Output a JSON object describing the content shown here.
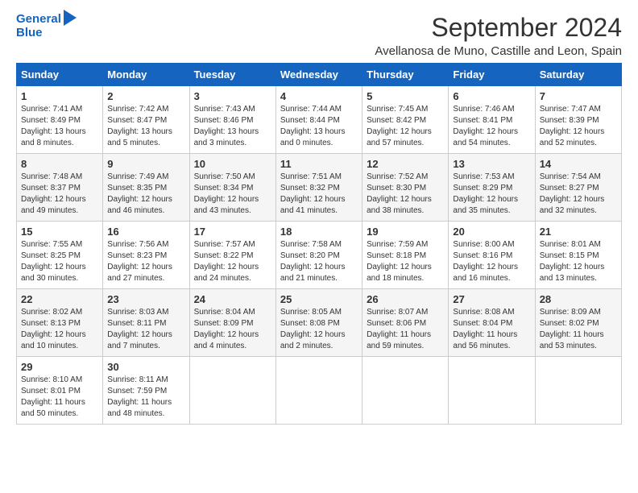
{
  "header": {
    "logo_line1": "General",
    "logo_line2": "Blue",
    "month_title": "September 2024",
    "location": "Avellanosa de Muno, Castille and Leon, Spain"
  },
  "weekdays": [
    "Sunday",
    "Monday",
    "Tuesday",
    "Wednesday",
    "Thursday",
    "Friday",
    "Saturday"
  ],
  "weeks": [
    [
      {
        "day": "1",
        "sunrise": "7:41 AM",
        "sunset": "8:49 PM",
        "daylight": "13 hours and 8 minutes."
      },
      {
        "day": "2",
        "sunrise": "7:42 AM",
        "sunset": "8:47 PM",
        "daylight": "13 hours and 5 minutes."
      },
      {
        "day": "3",
        "sunrise": "7:43 AM",
        "sunset": "8:46 PM",
        "daylight": "13 hours and 3 minutes."
      },
      {
        "day": "4",
        "sunrise": "7:44 AM",
        "sunset": "8:44 PM",
        "daylight": "13 hours and 0 minutes."
      },
      {
        "day": "5",
        "sunrise": "7:45 AM",
        "sunset": "8:42 PM",
        "daylight": "12 hours and 57 minutes."
      },
      {
        "day": "6",
        "sunrise": "7:46 AM",
        "sunset": "8:41 PM",
        "daylight": "12 hours and 54 minutes."
      },
      {
        "day": "7",
        "sunrise": "7:47 AM",
        "sunset": "8:39 PM",
        "daylight": "12 hours and 52 minutes."
      }
    ],
    [
      {
        "day": "8",
        "sunrise": "7:48 AM",
        "sunset": "8:37 PM",
        "daylight": "12 hours and 49 minutes."
      },
      {
        "day": "9",
        "sunrise": "7:49 AM",
        "sunset": "8:35 PM",
        "daylight": "12 hours and 46 minutes."
      },
      {
        "day": "10",
        "sunrise": "7:50 AM",
        "sunset": "8:34 PM",
        "daylight": "12 hours and 43 minutes."
      },
      {
        "day": "11",
        "sunrise": "7:51 AM",
        "sunset": "8:32 PM",
        "daylight": "12 hours and 41 minutes."
      },
      {
        "day": "12",
        "sunrise": "7:52 AM",
        "sunset": "8:30 PM",
        "daylight": "12 hours and 38 minutes."
      },
      {
        "day": "13",
        "sunrise": "7:53 AM",
        "sunset": "8:29 PM",
        "daylight": "12 hours and 35 minutes."
      },
      {
        "day": "14",
        "sunrise": "7:54 AM",
        "sunset": "8:27 PM",
        "daylight": "12 hours and 32 minutes."
      }
    ],
    [
      {
        "day": "15",
        "sunrise": "7:55 AM",
        "sunset": "8:25 PM",
        "daylight": "12 hours and 30 minutes."
      },
      {
        "day": "16",
        "sunrise": "7:56 AM",
        "sunset": "8:23 PM",
        "daylight": "12 hours and 27 minutes."
      },
      {
        "day": "17",
        "sunrise": "7:57 AM",
        "sunset": "8:22 PM",
        "daylight": "12 hours and 24 minutes."
      },
      {
        "day": "18",
        "sunrise": "7:58 AM",
        "sunset": "8:20 PM",
        "daylight": "12 hours and 21 minutes."
      },
      {
        "day": "19",
        "sunrise": "7:59 AM",
        "sunset": "8:18 PM",
        "daylight": "12 hours and 18 minutes."
      },
      {
        "day": "20",
        "sunrise": "8:00 AM",
        "sunset": "8:16 PM",
        "daylight": "12 hours and 16 minutes."
      },
      {
        "day": "21",
        "sunrise": "8:01 AM",
        "sunset": "8:15 PM",
        "daylight": "12 hours and 13 minutes."
      }
    ],
    [
      {
        "day": "22",
        "sunrise": "8:02 AM",
        "sunset": "8:13 PM",
        "daylight": "12 hours and 10 minutes."
      },
      {
        "day": "23",
        "sunrise": "8:03 AM",
        "sunset": "8:11 PM",
        "daylight": "12 hours and 7 minutes."
      },
      {
        "day": "24",
        "sunrise": "8:04 AM",
        "sunset": "8:09 PM",
        "daylight": "12 hours and 4 minutes."
      },
      {
        "day": "25",
        "sunrise": "8:05 AM",
        "sunset": "8:08 PM",
        "daylight": "12 hours and 2 minutes."
      },
      {
        "day": "26",
        "sunrise": "8:07 AM",
        "sunset": "8:06 PM",
        "daylight": "11 hours and 59 minutes."
      },
      {
        "day": "27",
        "sunrise": "8:08 AM",
        "sunset": "8:04 PM",
        "daylight": "11 hours and 56 minutes."
      },
      {
        "day": "28",
        "sunrise": "8:09 AM",
        "sunset": "8:02 PM",
        "daylight": "11 hours and 53 minutes."
      }
    ],
    [
      {
        "day": "29",
        "sunrise": "8:10 AM",
        "sunset": "8:01 PM",
        "daylight": "11 hours and 50 minutes."
      },
      {
        "day": "30",
        "sunrise": "8:11 AM",
        "sunset": "7:59 PM",
        "daylight": "11 hours and 48 minutes."
      },
      null,
      null,
      null,
      null,
      null
    ]
  ]
}
